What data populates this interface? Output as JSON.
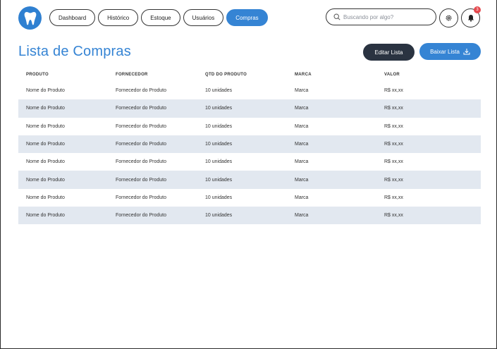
{
  "nav": {
    "items": [
      {
        "label": "Dashboard"
      },
      {
        "label": "Histórico"
      },
      {
        "label": "Estoque"
      },
      {
        "label": "Usuários"
      },
      {
        "label": "Compras",
        "active": true
      }
    ]
  },
  "search": {
    "placeholder": "Buscando por algo?"
  },
  "notifications": {
    "count": "3"
  },
  "page": {
    "title": "Lista de Compras"
  },
  "actions": {
    "edit_label": "Editar Lista",
    "download_label": "Baixar Lista"
  },
  "table": {
    "headers": [
      "PRODUTO",
      "FORNECEDOR",
      "QTD DO PRODUTO",
      "MARCA",
      "VALOR"
    ],
    "rows": [
      [
        "Nome do Produto",
        "Fornecedor do Produto",
        "10 unidades",
        "Marca",
        "R$ xx,xx"
      ],
      [
        "Nome do Produto",
        "Fornecedor do Produto",
        "10 unidades",
        "Marca",
        "R$ xx,xx"
      ],
      [
        "Nome do Produto",
        "Fornecedor do Produto",
        "10 unidades",
        "Marca",
        "R$ xx,xx"
      ],
      [
        "Nome do Produto",
        "Fornecedor do Produto",
        "10 unidades",
        "Marca",
        "R$ xx,xx"
      ],
      [
        "Nome do Produto",
        "Fornecedor do Produto",
        "10 unidades",
        "Marca",
        "R$ xx,xx"
      ],
      [
        "Nome do Produto",
        "Fornecedor do Produto",
        "10 unidades",
        "Marca",
        "R$ xx,xx"
      ],
      [
        "Nome do Produto",
        "Fornecedor do Produto",
        "10 unidades",
        "Marca",
        "R$ xx,xx"
      ],
      [
        "Nome do Produto",
        "Fornecedor do Produto",
        "10 unidades",
        "Marca",
        "R$ xx,xx"
      ]
    ]
  },
  "icons": {
    "logo": "tooth-icon",
    "search": "search-icon",
    "settings": "gear-icon",
    "notifications": "bell-icon",
    "download": "download-icon"
  },
  "colors": {
    "accent": "#3584d4",
    "dark": "#2a3341",
    "row_shade": "#e2e8f0",
    "badge": "#e5484d"
  }
}
